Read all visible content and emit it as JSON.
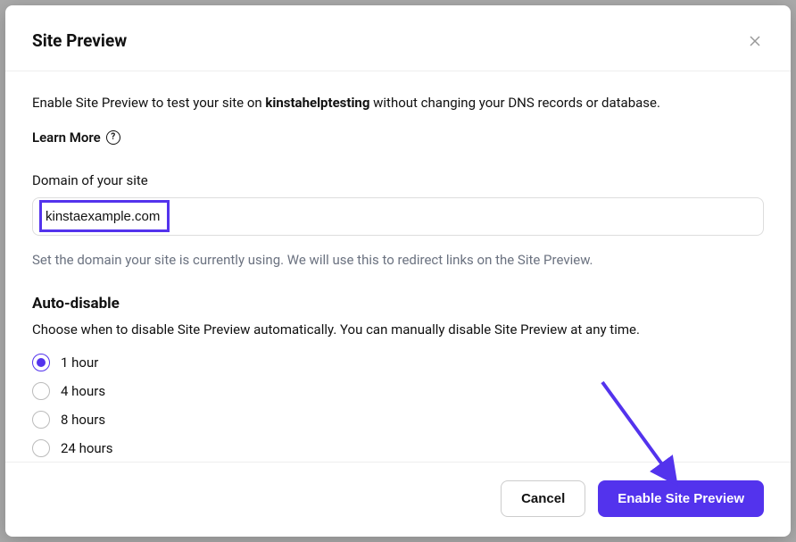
{
  "modal": {
    "title": "Site Preview",
    "intro_pre": "Enable Site Preview to test your site on ",
    "intro_bold": "kinstahelptesting",
    "intro_post": " without changing your DNS records or database.",
    "learn_more": "Learn More",
    "domain_label": "Domain of your site",
    "domain_value": "kinstaexample.com",
    "domain_hint": "Set the domain your site is currently using. We will use this to redirect links on the Site Preview.",
    "auto_disable_title": "Auto-disable",
    "auto_disable_desc": "Choose when to disable Site Preview automatically. You can manually disable Site Preview at any time.",
    "radio_options": [
      {
        "label": "1 hour",
        "selected": true
      },
      {
        "label": "4 hours",
        "selected": false
      },
      {
        "label": "8 hours",
        "selected": false
      },
      {
        "label": "24 hours",
        "selected": false
      }
    ],
    "cancel_label": "Cancel",
    "submit_label": "Enable Site Preview"
  }
}
